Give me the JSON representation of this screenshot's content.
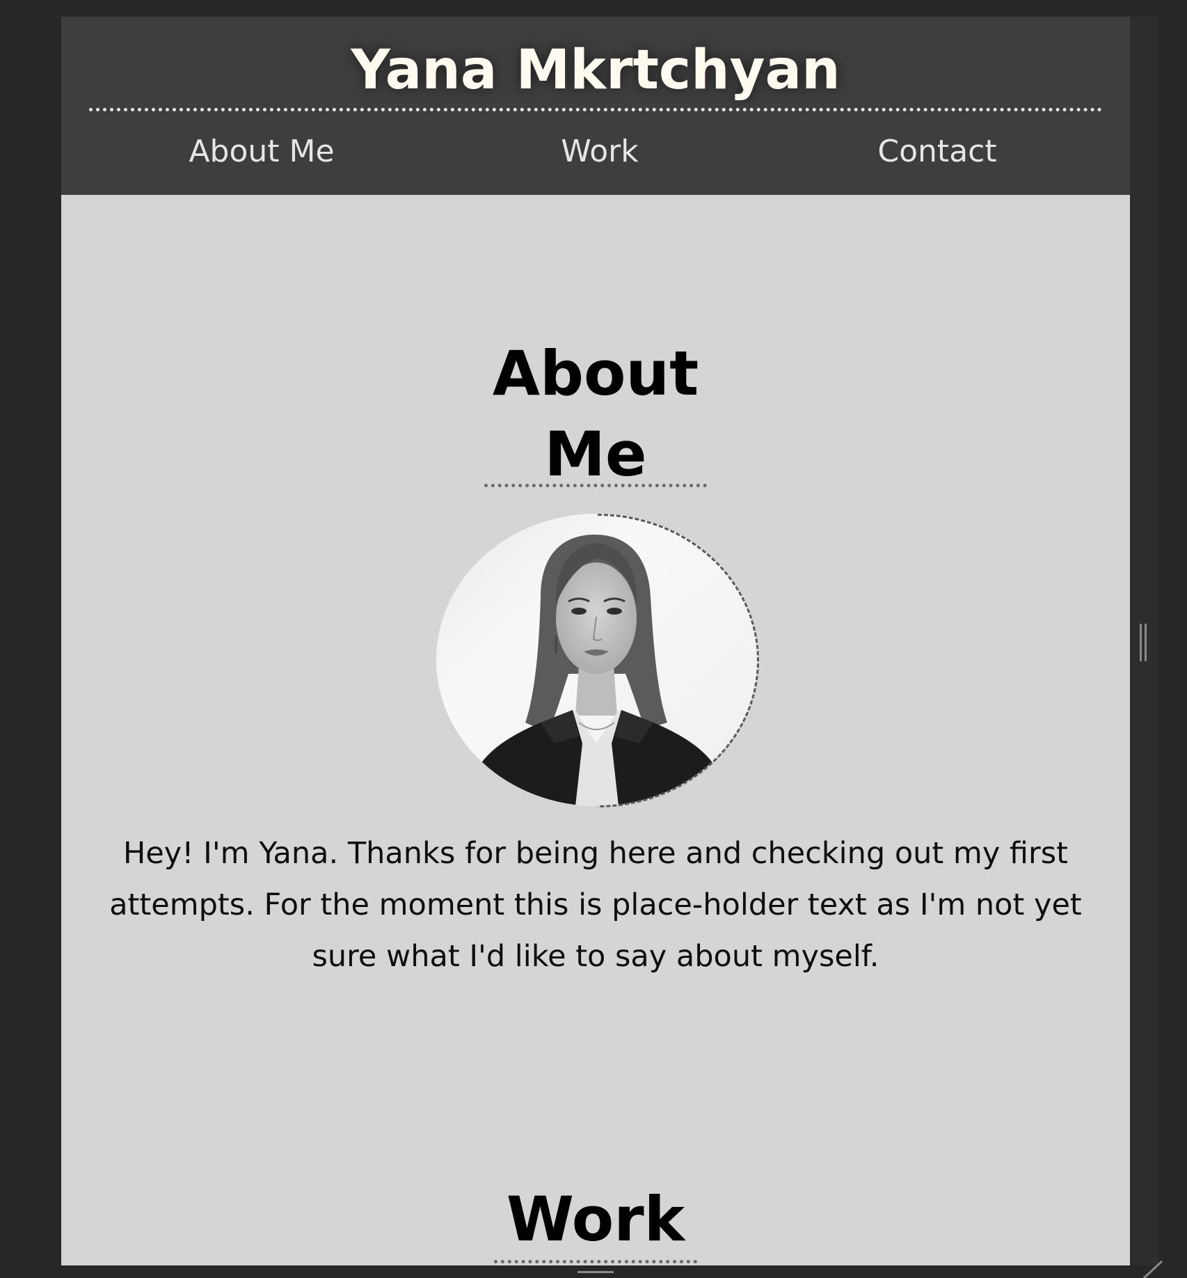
{
  "header": {
    "site_title": "Yana Mkrtchyan",
    "nav": [
      "About Me",
      "Work",
      "Contact"
    ]
  },
  "about": {
    "heading_line1": "About",
    "heading_line2": "Me",
    "portrait_alt": "Portrait of Yana Mkrtchyan",
    "text": "Hey! I'm Yana. Thanks for being here and checking out my first attempts. For the moment this is place-holder text as I'm not yet sure what I'd like to say about myself."
  },
  "work": {
    "heading": "Work"
  },
  "colors": {
    "page_bg": "#272727",
    "header_bg": "#3e3e3e",
    "content_bg": "#d5d5d5",
    "title_text": "#fffaf0",
    "nav_text": "#e6e6e6"
  }
}
